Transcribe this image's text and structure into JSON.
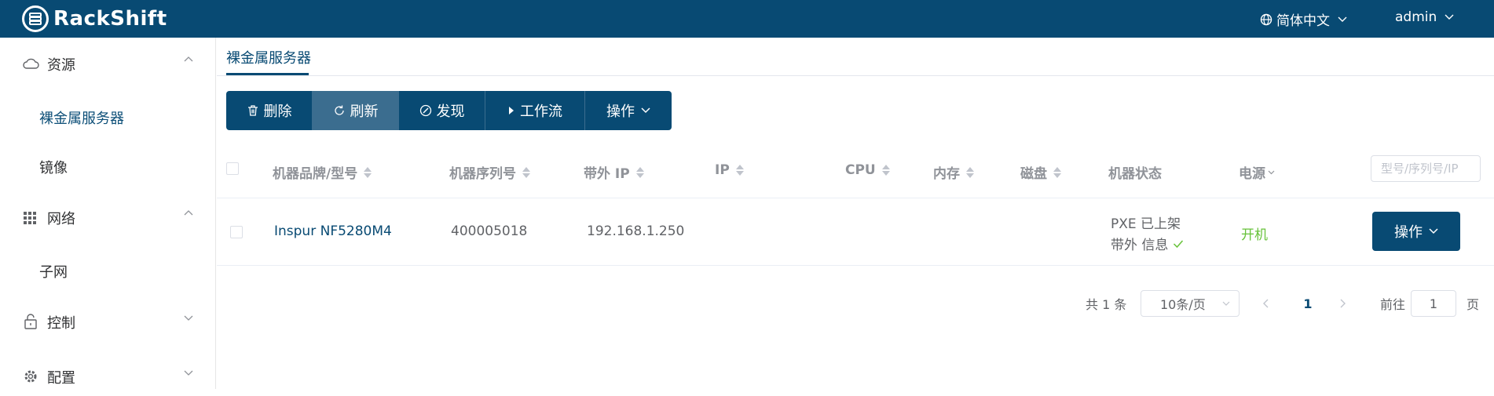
{
  "header": {
    "app_name": "RackShift",
    "language": "简体中文",
    "user": "admin"
  },
  "sidebar": {
    "groups": [
      {
        "label": "资源",
        "icon": "cloud-icon",
        "expanded": true,
        "items": [
          {
            "label": "裸金属服务器",
            "active": true
          },
          {
            "label": "镜像",
            "active": false
          }
        ]
      },
      {
        "label": "网络",
        "icon": "grid-icon",
        "expanded": true,
        "items": [
          {
            "label": "子网",
            "active": false
          }
        ]
      },
      {
        "label": "控制",
        "icon": "lock-icon",
        "expanded": false,
        "items": []
      },
      {
        "label": "配置",
        "icon": "gear-icon",
        "expanded": false,
        "items": []
      }
    ]
  },
  "tabs": [
    {
      "label": "裸金属服务器",
      "active": true
    }
  ],
  "toolbar": {
    "delete_label": "删除",
    "refresh_label": "刷新",
    "discover_label": "发现",
    "workflow_label": "工作流",
    "actions_label": "操作"
  },
  "table": {
    "columns": [
      "机器品牌/型号",
      "机器序列号",
      "带外 IP",
      "IP",
      "CPU",
      "内存",
      "磁盘",
      "机器状态",
      "电源"
    ],
    "search_placeholder": "型号/序列号/IP",
    "rows": [
      {
        "model": "Inspur NF5280M4",
        "serial": "400005018",
        "bmc_ip": "192.168.1.250",
        "ip": "",
        "cpu": "",
        "memory": "",
        "disk": "",
        "status_line1": "PXE 已上架",
        "status_line2": "带外 信息",
        "power": "开机",
        "action_label": "操作"
      }
    ]
  },
  "pagination": {
    "total_text": "共 1 条",
    "page_size": "10条/页",
    "current_page": "1",
    "goto_label": "前往",
    "goto_value": "1",
    "page_suffix": "页"
  },
  "colors": {
    "primary": "#084a73",
    "primary_light": "#3b6d8f",
    "success": "#67c23a"
  }
}
